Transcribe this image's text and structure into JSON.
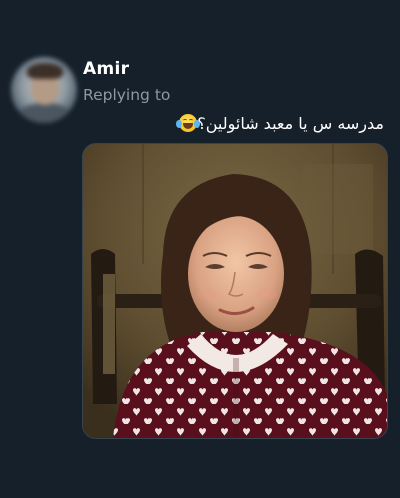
{
  "tweet": {
    "author_name": "Amir",
    "replying_label": "Replying to",
    "text": "مدرسه س يا معبد شائولين؟",
    "emoji_icon": "face-with-tears-of-joy",
    "media": {
      "type": "image",
      "icon": "photo"
    }
  },
  "colors": {
    "background": "#15202b",
    "secondary_text": "#8b98a5",
    "border": "#38444d"
  }
}
